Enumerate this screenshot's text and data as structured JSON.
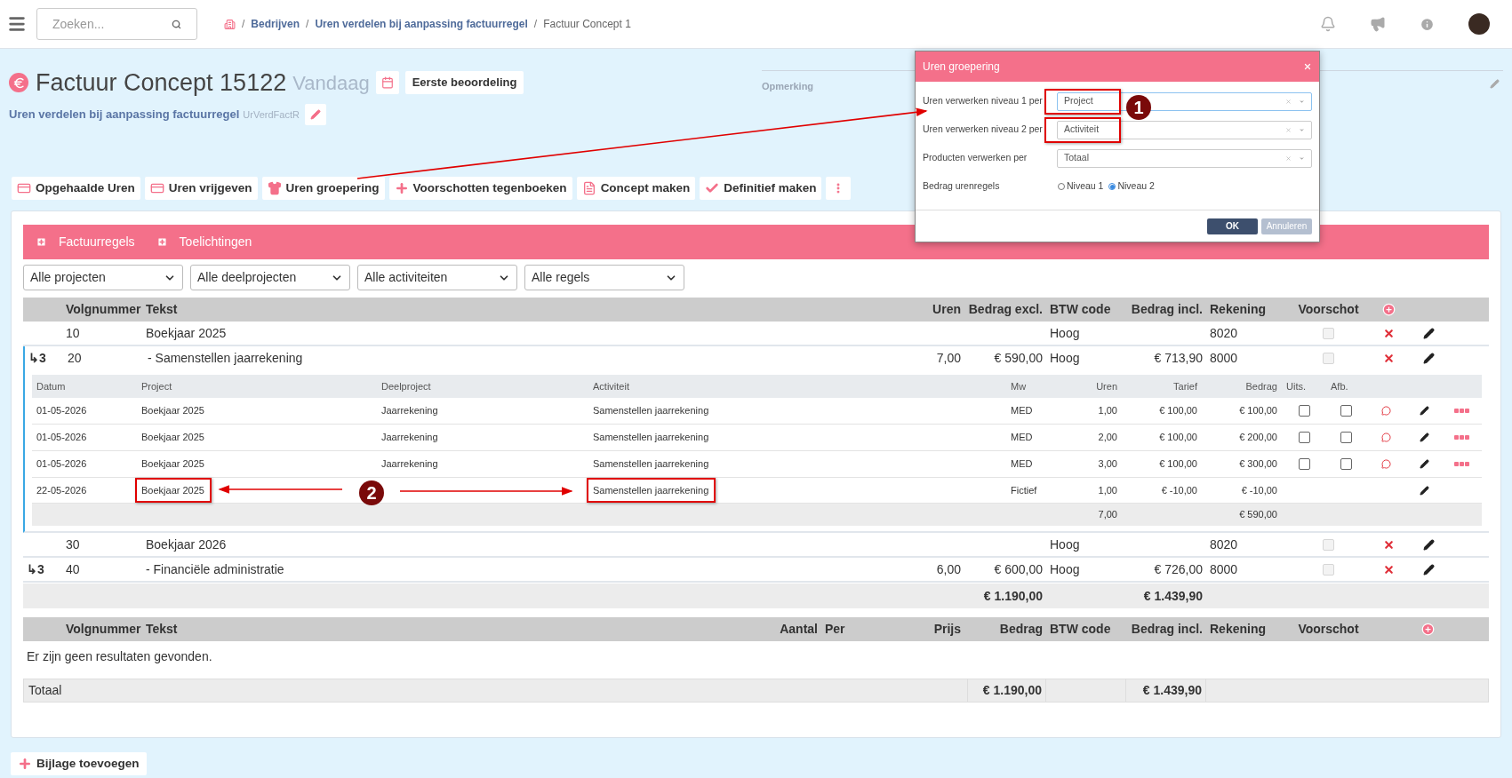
{
  "topbar": {
    "search": {
      "placeholder": "Zoeken..."
    },
    "breadcrumbs": [
      {
        "separator": "/",
        "label": "Bedrijven",
        "link": true
      },
      {
        "separator": "/",
        "label": "Uren verdelen bij aanpassing factuurregel",
        "link": true
      },
      {
        "separator": "/",
        "label": "Factuur Concept 1",
        "link": false
      }
    ]
  },
  "header": {
    "title": "Factuur Concept 15122",
    "date": "Vandaag",
    "status_button": "Eerste beoordeling",
    "subtitle": "Uren verdelen bij aanpassing factuurregel",
    "code": "UrVerdFactR",
    "remark_label": "Opmerking"
  },
  "toolbar": [
    {
      "label": "Opgehaalde Uren",
      "kind": "card"
    },
    {
      "label": "Uren vrijgeven",
      "kind": "card"
    },
    {
      "label": "Uren groepering",
      "kind": "group"
    },
    {
      "label": "Voorschotten tegenboeken",
      "kind": "plus"
    },
    {
      "label": "Concept maken",
      "kind": "pdf"
    },
    {
      "label": "Definitief maken",
      "kind": "check"
    }
  ],
  "tabs": [
    {
      "label": "Factuurregels"
    },
    {
      "label": "Toelichtingen"
    }
  ],
  "filters": [
    {
      "value": "Alle projecten"
    },
    {
      "value": "Alle deelprojecten"
    },
    {
      "value": "Alle activiteiten"
    },
    {
      "value": "Alle regels"
    }
  ],
  "invoice_lines": {
    "columns": [
      "Volgnummer",
      "Tekst",
      "Uren",
      "Bedrag excl.",
      "BTW code",
      "Bedrag incl.",
      "Rekening",
      "Voorschot"
    ],
    "rows": [
      {
        "number": "10",
        "text": "Boekjaar 2025",
        "btw": "Hoog",
        "account": "8020",
        "advance": false,
        "expanded": false
      },
      {
        "indicator": "↳3",
        "number": "20",
        "text": "- Samenstellen jaarrekening",
        "hours": "7,00",
        "excl": "€ 590,00",
        "btw": "Hoog",
        "incl": "€ 713,90",
        "account": "8000",
        "advance": false,
        "expanded": true,
        "details": {
          "columns": [
            "Datum",
            "Project",
            "Deelproject",
            "Activiteit",
            "Mw",
            "Uren",
            "Tarief",
            "Bedrag",
            "Uits.",
            "Afb."
          ],
          "rows": [
            {
              "kind": "entry",
              "date": "01-05-2026",
              "project": "Boekjaar 2025",
              "subproject": "Jaarrekening",
              "activity": "Samenstellen jaarrekening",
              "employee": "MED",
              "hours": "1,00",
              "rate": "€ 100,00",
              "amount": "€ 100,00",
              "uits": false,
              "afb": false,
              "project_highlighted": false,
              "activity_highlighted": false
            },
            {
              "kind": "entry",
              "date": "01-05-2026",
              "project": "Boekjaar 2025",
              "subproject": "Jaarrekening",
              "activity": "Samenstellen jaarrekening",
              "employee": "MED",
              "hours": "2,00",
              "rate": "€ 100,00",
              "amount": "€ 200,00",
              "uits": false,
              "afb": false,
              "project_highlighted": false,
              "activity_highlighted": false
            },
            {
              "kind": "entry",
              "date": "01-05-2026",
              "project": "Boekjaar 2025",
              "subproject": "Jaarrekening",
              "activity": "Samenstellen jaarrekening",
              "employee": "MED",
              "hours": "3,00",
              "rate": "€ 100,00",
              "amount": "€ 300,00",
              "uits": false,
              "afb": false,
              "project_highlighted": false,
              "activity_highlighted": false
            },
            {
              "kind": "correction",
              "date": "22-05-2026",
              "project": "Boekjaar 2025",
              "activity": "Samenstellen jaarrekening",
              "employee": "Fictief",
              "hours": "1,00",
              "rate": "€ -10,00",
              "amount": "€ -10,00",
              "project_highlighted": true,
              "activity_highlighted": true
            }
          ],
          "total": {
            "hours": "7,00",
            "amount": "€ 590,00"
          }
        }
      },
      {
        "number": "30",
        "text": "Boekjaar 2026",
        "btw": "Hoog",
        "account": "8020",
        "advance": false,
        "expanded": false
      },
      {
        "indicator": "↳3",
        "number": "40",
        "text": "- Financiële administratie",
        "hours": "6,00",
        "excl": "€ 600,00",
        "btw": "Hoog",
        "incl": "€ 726,00",
        "account": "8000",
        "advance": false,
        "expanded": false
      }
    ],
    "totals": {
      "excl": "€ 1.190,00",
      "incl": "€ 1.439,90"
    }
  },
  "products": {
    "columns": [
      "Volgnummer",
      "Tekst",
      "Aantal",
      "Per",
      "Prijs",
      "Bedrag",
      "BTW code",
      "Bedrag incl.",
      "Rekening",
      "Voorschot"
    ],
    "empty_message": "Er zijn geen resultaten gevonden.",
    "total_label": "Totaal",
    "total_amount": "€ 1.190,00",
    "total_incl": "€ 1.439,90"
  },
  "attachment_button": "Bijlage toevoegen",
  "dialog": {
    "title": "Uren groepering",
    "fields": [
      {
        "label": "Uren verwerken niveau 1 per",
        "value": "Project",
        "highlighted": true,
        "focused": true
      },
      {
        "label": "Uren verwerken niveau 2 per",
        "value": "Activiteit",
        "highlighted": true,
        "focused": false
      },
      {
        "label": "Producten verwerken per",
        "value": "Totaal",
        "highlighted": false,
        "focused": false
      }
    ],
    "radio": {
      "label": "Bedrag urenregels",
      "options": [
        {
          "label": "Niveau 1",
          "selected": false
        },
        {
          "label": "Niveau 2",
          "selected": true
        }
      ]
    },
    "buttons": [
      {
        "label": "OK",
        "kind": "primary"
      },
      {
        "label": "Annuleren",
        "kind": "secondary"
      }
    ]
  },
  "annotations": [
    {
      "label": "1"
    },
    {
      "label": "2"
    }
  ]
}
